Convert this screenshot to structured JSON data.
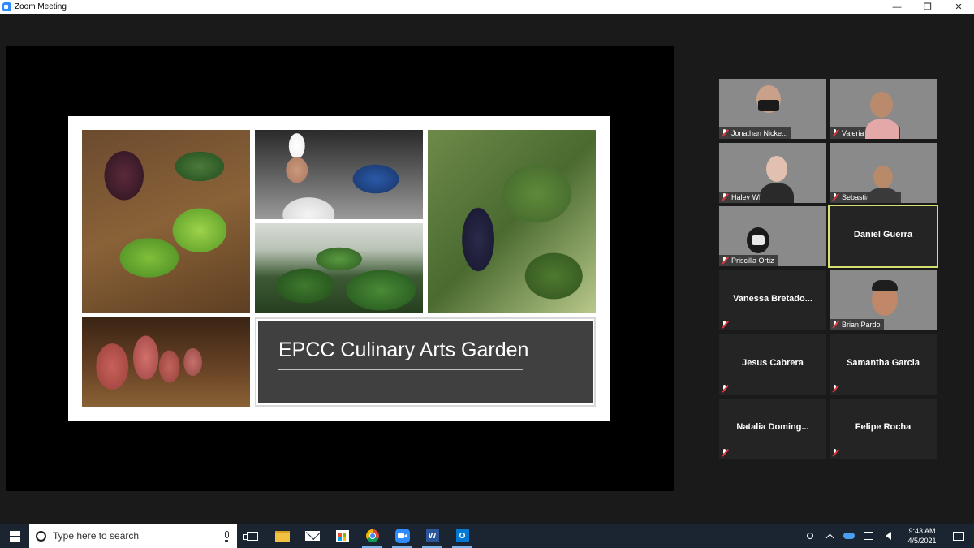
{
  "window": {
    "title": "Zoom Meeting",
    "minimize_glyph": "—",
    "restore_glyph": "❐",
    "close_glyph": "✕"
  },
  "slide": {
    "title": "EPCC Culinary Arts Garden"
  },
  "participants": [
    {
      "name": "Jonathan Nicke...",
      "video": true,
      "muted": true
    },
    {
      "name": "Valeria O. Dom...",
      "video": true,
      "muted": true
    },
    {
      "name": "Haley White",
      "video": true,
      "muted": true
    },
    {
      "name": "Sebastian Garcia",
      "video": true,
      "muted": true
    },
    {
      "name": "Priscilla Ortiz",
      "video": true,
      "muted": true
    },
    {
      "name": "Daniel Guerra",
      "video": false,
      "muted": false,
      "active_speaker": true
    },
    {
      "name": "Vanessa  Bretado...",
      "video": false,
      "muted": true
    },
    {
      "name": "Brian Pardo",
      "video": true,
      "muted": true
    },
    {
      "name": "Jesus Cabrera",
      "video": false,
      "muted": true
    },
    {
      "name": "Samantha Garcia",
      "video": false,
      "muted": true
    },
    {
      "name": "Natalia  Doming...",
      "video": false,
      "muted": true
    },
    {
      "name": "Felipe Rocha",
      "video": false,
      "muted": true
    }
  ],
  "taskbar": {
    "search_placeholder": "Type here to search",
    "apps": [
      "task-view",
      "file-explorer",
      "mail",
      "microsoft-store",
      "chrome",
      "zoom",
      "word",
      "outlook"
    ],
    "word_letter": "W",
    "outlook_letter": "O",
    "time": "9:43 AM",
    "date": "4/5/2021"
  },
  "colors": {
    "active_speaker_border": "#d8e070",
    "muted_mic": "#e0383e",
    "zoom_blue": "#2d8cff",
    "taskbar_bg": "#1b2431"
  }
}
